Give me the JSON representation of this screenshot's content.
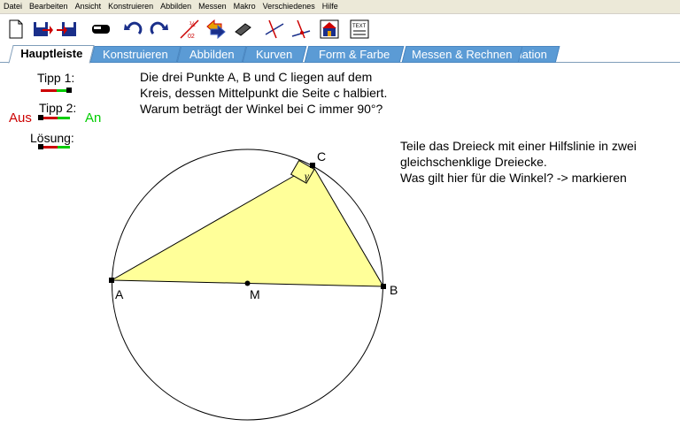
{
  "menu": [
    "Datei",
    "Bearbeiten",
    "Ansicht",
    "Konstruieren",
    "Abbilden",
    "Messen",
    "Makro",
    "Verschiedenes",
    "Hilfe"
  ],
  "toolbar": {
    "icons": [
      "new-file-icon",
      "open-icon",
      "save-icon",
      "eraser-icon",
      "undo-icon",
      "redo-icon",
      "fraction-icon",
      "color-arrows-icon",
      "pencil-icon",
      "line-tool-icon",
      "angle-tool-icon",
      "segment-tool-icon",
      "house-icon",
      "text-tool-icon"
    ],
    "fraction_top": "1/2",
    "fraction_bottom": "02",
    "text_icon_label": "TEXT"
  },
  "tabs": [
    "Hauptleiste",
    "Konstruieren",
    "Abbilden",
    "Kurven",
    "Form & Farbe",
    "Messen & Rechnen",
    "Animation"
  ],
  "active_tab": "Hauptleiste",
  "controls": {
    "tipp1": "Tipp 1:",
    "tipp2": "Tipp 2:",
    "loesung": "Lösung:",
    "aus": "Aus",
    "an": "An"
  },
  "problem_text": [
    "Die drei Punkte A, B und C liegen auf dem",
    "Kreis, dessen Mittelpunkt die Seite c halbiert.",
    "Warum beträgt der Winkel bei C immer 90°?"
  ],
  "hint_text": [
    "Teile das Dreieck mit einer Hilfslinie in zwei",
    "gleichschenklige Dreiecke.",
    "Was gilt hier für die Winkel? -> markieren"
  ],
  "figure": {
    "point_a": "A",
    "point_b": "B",
    "point_c": "C",
    "point_m": "M",
    "angle_label": "γ",
    "triangle_color": "#ffff99"
  },
  "colors": {
    "aus": "#cc0000",
    "an": "#00cc00",
    "tab": "#5b9bd5"
  }
}
